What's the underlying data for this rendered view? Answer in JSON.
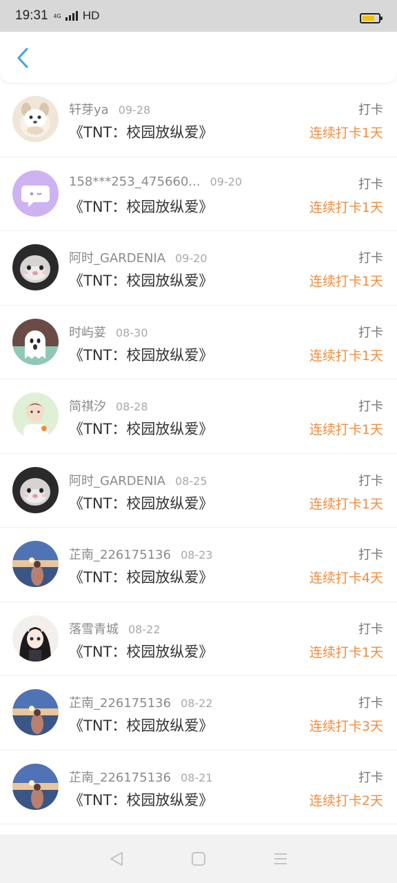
{
  "status_bar": {
    "time": "19:31",
    "network": "4G",
    "hd": "HD"
  },
  "header": {
    "back_icon": "chevron-left-icon",
    "accent": "#3aa3e3"
  },
  "colors": {
    "streak": "#f08c3c",
    "name": "#8a8a8a",
    "title": "#333333"
  },
  "items": [
    {
      "name": "轩芽ya",
      "date": "09-28",
      "title": "《TNT：校园放纵爱》",
      "action": "打卡",
      "streak": "连续打卡1天",
      "avatar": "dog-avatar"
    },
    {
      "name": "158***253_475660...",
      "date": "09-20",
      "title": "《TNT：校园放纵爱》",
      "action": "打卡",
      "streak": "连续打卡1天",
      "avatar": "default-chat-avatar"
    },
    {
      "name": "阿时_GARDENIA",
      "date": "09-20",
      "title": "《TNT：校园放纵爱》",
      "action": "打卡",
      "streak": "连续打卡1天",
      "avatar": "plush-avatar"
    },
    {
      "name": "时屿荽",
      "date": "08-30",
      "title": "《TNT：校园放纵爱》",
      "action": "打卡",
      "streak": "连续打卡1天",
      "avatar": "ghost-avatar"
    },
    {
      "name": "简祺汐",
      "date": "08-28",
      "title": "《TNT：校园放纵爱》",
      "action": "打卡",
      "streak": "连续打卡1天",
      "avatar": "boy-avatar"
    },
    {
      "name": "阿时_GARDENIA",
      "date": "08-25",
      "title": "《TNT：校园放纵爱》",
      "action": "打卡",
      "streak": "连续打卡1天",
      "avatar": "plush-avatar"
    },
    {
      "name": "芷南_226175136",
      "date": "08-23",
      "title": "《TNT：校园放纵爱》",
      "action": "打卡",
      "streak": "连续打卡4天",
      "avatar": "sea-girl-avatar"
    },
    {
      "name": "落雪青城",
      "date": "08-22",
      "title": "《TNT：校园放纵爱》",
      "action": "打卡",
      "streak": "连续打卡1天",
      "avatar": "anime-girl-avatar"
    },
    {
      "name": "芷南_226175136",
      "date": "08-22",
      "title": "《TNT：校园放纵爱》",
      "action": "打卡",
      "streak": "连续打卡3天",
      "avatar": "sea-girl-avatar"
    },
    {
      "name": "芷南_226175136",
      "date": "08-21",
      "title": "《TNT：校园放纵爱》",
      "action": "打卡",
      "streak": "连续打卡2天",
      "avatar": "sea-girl-avatar"
    }
  ],
  "nav": {
    "back": "nav-back-icon",
    "home": "nav-home-icon",
    "menu": "nav-menu-icon"
  }
}
